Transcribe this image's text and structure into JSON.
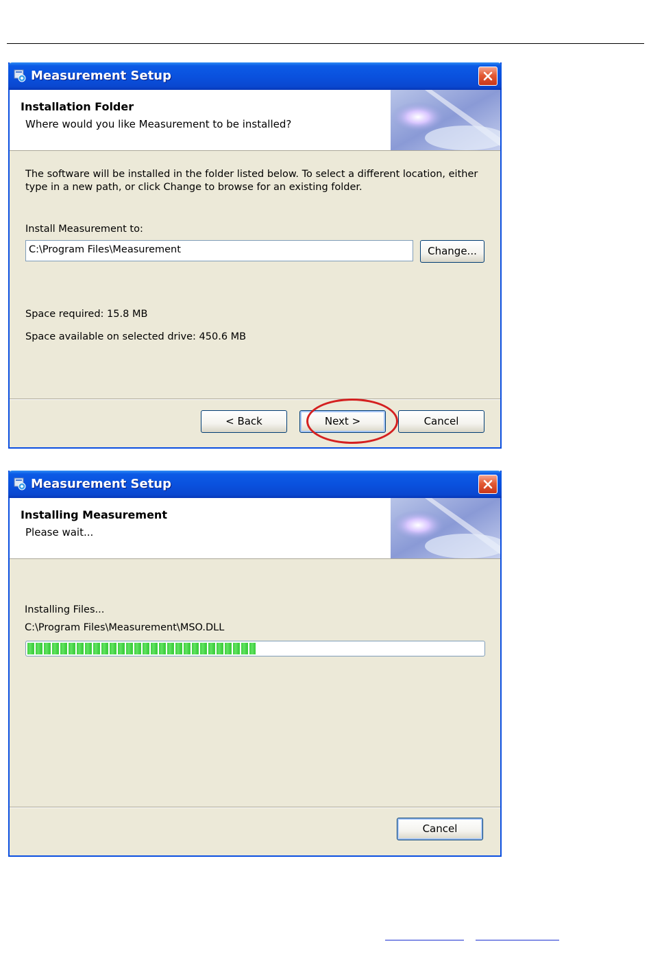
{
  "window1": {
    "title": "Measurement Setup",
    "header": {
      "title": "Installation Folder",
      "subtitle": "Where would you like Measurement to be installed?"
    },
    "description": "The software will be installed in the folder listed below. To select a different location, either type in a new path, or click Change to browse for an existing folder.",
    "install_label": "Install Measurement to:",
    "install_path": "C:\\Program Files\\Measurement",
    "change_button": "Change...",
    "space_required": "Space required: 15.8 MB",
    "space_available": "Space available on selected drive: 450.6 MB",
    "back_button": "< Back",
    "next_button": "Next >",
    "cancel_button": "Cancel"
  },
  "window2": {
    "title": "Measurement Setup",
    "header": {
      "title": "Installing Measurement",
      "subtitle": "Please wait..."
    },
    "status_label": "Installing Files...",
    "current_file": "C:\\Program Files\\Measurement\\MSO.DLL",
    "progress_fraction": 0.5,
    "cancel_button": "Cancel"
  },
  "colors": {
    "titlebar": "#0a50dd",
    "window_bg": "#ece9d8",
    "progress_green": "#3fcf3f",
    "annotation_red": "#d42020",
    "close_button": "#e35a34"
  },
  "icons": [
    "setup-icon",
    "close-icon",
    "header-art"
  ]
}
